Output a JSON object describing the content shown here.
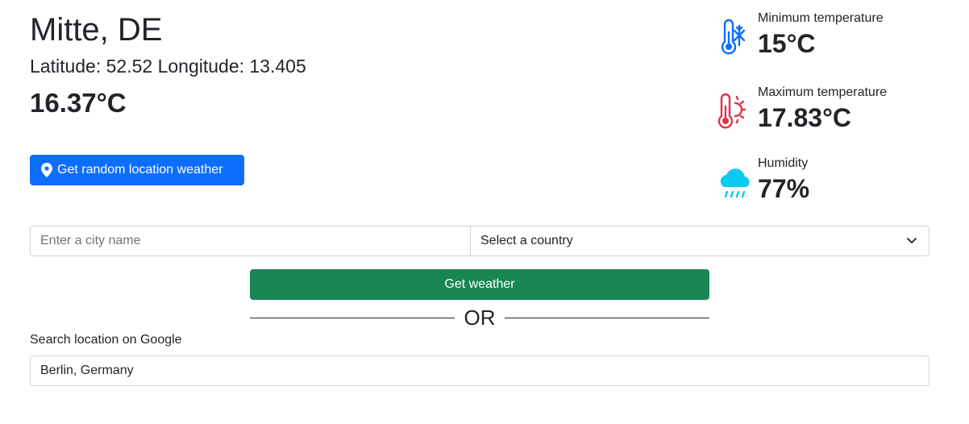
{
  "location": {
    "title": "Mitte, DE",
    "coords": "Latitude: 52.52 Longitude: 13.405",
    "current_temp": "16.37°C"
  },
  "random_button": {
    "label": "Get random location weather",
    "icon": "map-pin-icon",
    "color": "#0d6efd"
  },
  "stats": {
    "min": {
      "label": "Minimum temperature",
      "value": "15°C",
      "icon": "thermometer-snow-icon",
      "color": "#0d6efd"
    },
    "max": {
      "label": "Maximum temperature",
      "value": "17.83°C",
      "icon": "thermometer-sun-icon",
      "color": "#dc3545"
    },
    "humidity": {
      "label": "Humidity",
      "value": "77%",
      "icon": "cloud-rain-icon",
      "color": "#0dcaf0"
    }
  },
  "search": {
    "city_placeholder": "Enter a city name",
    "city_value": "",
    "country_selected": "Select a country"
  },
  "weather_button": {
    "label": "Get weather",
    "color": "#198754"
  },
  "divider": {
    "text": "OR"
  },
  "google": {
    "label": "Search location on Google",
    "value": "Berlin, Germany"
  }
}
